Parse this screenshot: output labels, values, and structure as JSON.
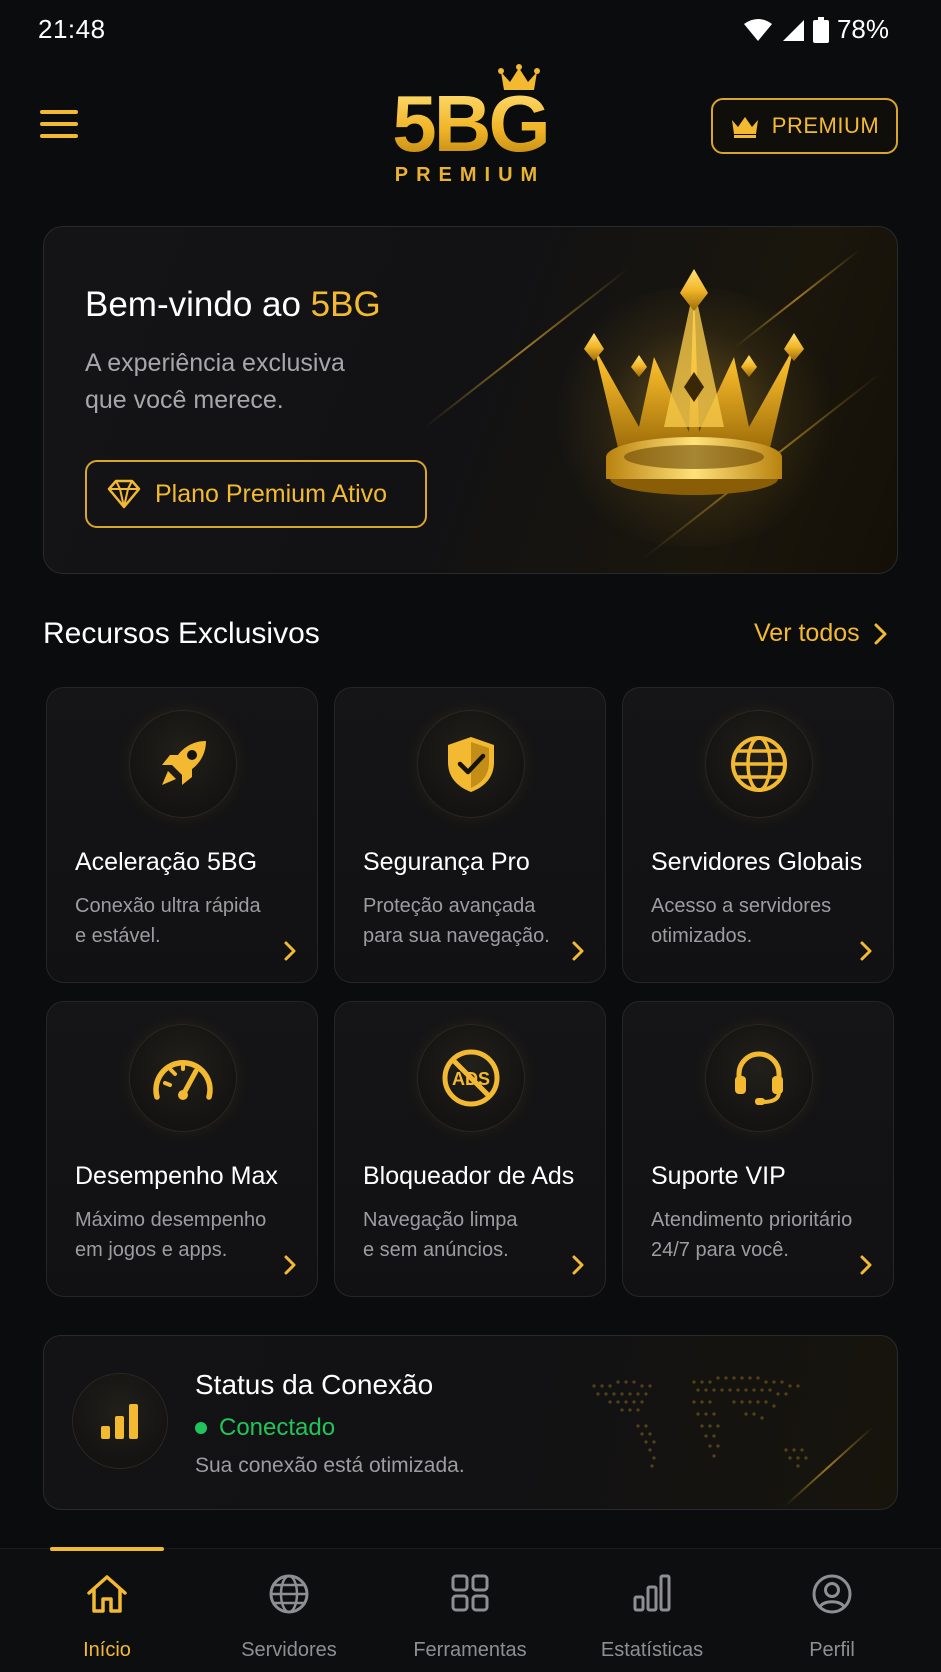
{
  "status_bar": {
    "time": "21:48",
    "battery": "78%"
  },
  "header": {
    "logo_main": "5BG",
    "logo_sub": "PREMIUM",
    "premium_label": "PREMIUM"
  },
  "hero": {
    "title_prefix": "Bem-vindo ao ",
    "title_brand": "5BG",
    "subtitle_line1": "A experiência exclusiva",
    "subtitle_line2": "que você merece.",
    "button_label": "Plano Premium Ativo"
  },
  "features": {
    "section_title": "Recursos Exclusivos",
    "see_all_label": "Ver todos",
    "items": [
      {
        "title": "Aceleração 5BG",
        "desc_line1": "Conexão ultra rápida",
        "desc_line2": "e estável.",
        "icon": "rocket-icon"
      },
      {
        "title": "Segurança Pro",
        "desc_line1": "Proteção avançada",
        "desc_line2": "para sua navegação.",
        "icon": "shield-check-icon"
      },
      {
        "title": "Servidores Globais",
        "desc_line1": "Acesso a servidores",
        "desc_line2": "otimizados.",
        "icon": "globe-icon"
      },
      {
        "title": "Desempenho Max",
        "desc_line1": "Máximo desempenho",
        "desc_line2": "em jogos e apps.",
        "icon": "speedometer-icon"
      },
      {
        "title": "Bloqueador de Ads",
        "desc_line1": "Navegação limpa",
        "desc_line2": "e sem anúncios.",
        "icon": "ads-block-icon",
        "icon_text": "ADS"
      },
      {
        "title": "Suporte VIP",
        "desc_line1": "Atendimento prioritário",
        "desc_line2": "24/7 para você.",
        "icon": "headset-icon"
      }
    ]
  },
  "connection": {
    "title": "Status da Conexão",
    "state": "Conectado",
    "description": "Sua conexão está otimizada."
  },
  "bottom_nav": {
    "items": [
      {
        "label": "Início",
        "icon": "home-icon",
        "active": true
      },
      {
        "label": "Servidores",
        "icon": "globe-icon",
        "active": false
      },
      {
        "label": "Ferramentas",
        "icon": "grid-icon",
        "active": false
      },
      {
        "label": "Estatísticas",
        "icon": "bar-chart-icon",
        "active": false
      },
      {
        "label": "Perfil",
        "icon": "user-icon",
        "active": false
      }
    ]
  },
  "colors": {
    "accent": "#f3b931",
    "background": "#0b0c0e",
    "success": "#21c45a",
    "muted_text": "#9d9da1"
  }
}
